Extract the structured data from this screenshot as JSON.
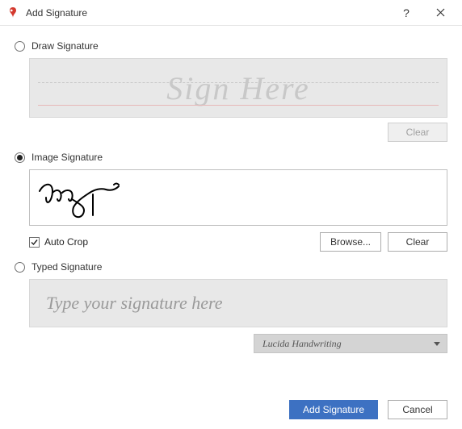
{
  "title": "Add Signature",
  "options": {
    "draw": {
      "label": "Draw Signature",
      "selected": false
    },
    "image": {
      "label": "Image Signature",
      "selected": true
    },
    "typed": {
      "label": "Typed Signature",
      "selected": false
    }
  },
  "draw": {
    "placeholder": "Sign Here",
    "clear_label": "Clear"
  },
  "image": {
    "auto_crop_label": "Auto Crop",
    "auto_crop_checked": true,
    "browse_label": "Browse...",
    "clear_label": "Clear"
  },
  "typed": {
    "placeholder": "Type your signature here",
    "font_selected": "Lucida Handwriting"
  },
  "footer": {
    "ok_label": "Add Signature",
    "cancel_label": "Cancel"
  },
  "icons": {
    "help": "?"
  }
}
